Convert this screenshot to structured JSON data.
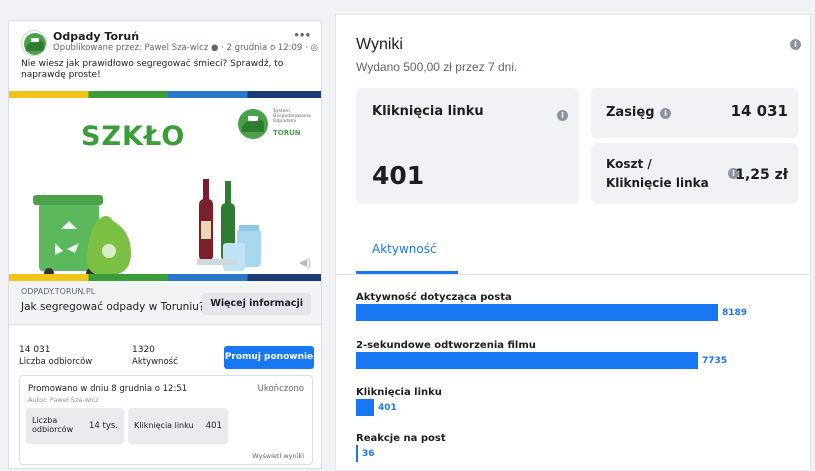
{
  "post": {
    "page_name": "Odpady Toruń",
    "meta": "Opublikowane przez: Pawel Sza-wicz ● · 2 grudnia o 12:09 · ◎",
    "more_icon": "more-horizontal-icon",
    "text": "Nie wiesz jak prawidłowo segregować śmieci? Sprawdź, to naprawdę proste!",
    "creative": {
      "headline": "SZKŁO",
      "brand_lines": [
        "System",
        "Gospodarowania",
        "Odpadami"
      ],
      "brand_name": "TORUŃ",
      "colors": {
        "green": "#3a9d3a",
        "yellow": "#f0c419",
        "blue": "#2c78c8",
        "navy": "#1f3b73"
      }
    },
    "link": {
      "domain": "ODPADY.TORUN.PL",
      "title": "Jak segregować odpady w Toruniu?",
      "button": "Więcej informacji"
    },
    "stats": {
      "reach_value": "14 031",
      "reach_label": "Liczba odbiorców",
      "activity_value": "1320",
      "activity_label": "Aktywność",
      "promote_button": "Promuj ponownie"
    },
    "promotion": {
      "promoted_on": "Promowano w dniu 8 grudnia o 12:51",
      "status": "Ukończono",
      "author": "Autor: Paweł Sza-wicz",
      "reach_label": "Liczba odbiorców",
      "reach_value": "14 tys.",
      "clicks_label": "Kliknięcia linku",
      "clicks_value": "401",
      "view_results": "Wyświetl wyniki"
    }
  },
  "results": {
    "title": "Wyniki",
    "subtitle": "Wydano 500,00 zł przez 7 dni.",
    "link_clicks_label": "Kliknięcia linku",
    "link_clicks_value": "401",
    "reach_label": "Zasięg",
    "reach_value": "14 031",
    "cpc_label_1": "Koszt /",
    "cpc_label_2": "Kliknięcie linka",
    "cpc_value": "1,25 zł",
    "tab": "Aktywność",
    "metrics": [
      {
        "label": "Aktywność dotycząca posta",
        "value": "8189",
        "n": 8189
      },
      {
        "label": "2-sekundowe odtworzenia filmu",
        "value": "7735",
        "n": 7735
      },
      {
        "label": "Kliknięcia linku",
        "value": "401",
        "n": 401
      },
      {
        "label": "Reakcje na post",
        "value": "36",
        "n": 36
      }
    ],
    "accent_color": "#1877f2"
  }
}
